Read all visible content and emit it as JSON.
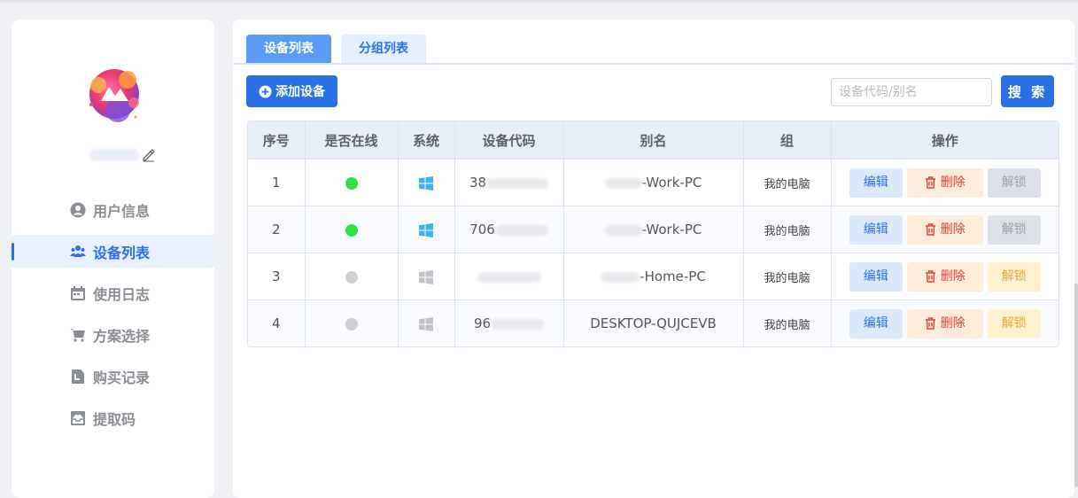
{
  "sidebar": {
    "items": [
      {
        "label": "用户信息",
        "icon": "user-circle-icon",
        "active": false
      },
      {
        "label": "设备列表",
        "icon": "users-group-icon",
        "active": true
      },
      {
        "label": "使用日志",
        "icon": "calendar-icon",
        "active": false
      },
      {
        "label": "方案选择",
        "icon": "cart-icon",
        "active": false
      },
      {
        "label": "购买记录",
        "icon": "document-icon",
        "active": false
      },
      {
        "label": "提取码",
        "icon": "inbox-icon",
        "active": false
      }
    ]
  },
  "tabs": [
    {
      "label": "设备列表",
      "active": true
    },
    {
      "label": "分组列表",
      "active": false
    }
  ],
  "toolbar": {
    "add_label": "添加设备",
    "search_placeholder": "设备代码/别名",
    "search_label": "搜 索"
  },
  "table": {
    "headers": [
      "序号",
      "是否在线",
      "系统",
      "设备代码",
      "别名",
      "组",
      "操作"
    ],
    "rows": [
      {
        "index": "1",
        "online": true,
        "system": "windows-icon",
        "code_visible": "38",
        "alias_visible": "-Work-PC",
        "group": "我的电脑",
        "unlock_enabled": false
      },
      {
        "index": "2",
        "online": true,
        "system": "windows-icon",
        "code_visible": "706",
        "alias_visible": "-Work-PC",
        "group": "我的电脑",
        "unlock_enabled": false
      },
      {
        "index": "3",
        "online": false,
        "system": "windows-icon",
        "code_visible": "",
        "alias_visible": "-Home-PC",
        "group": "我的电脑",
        "unlock_enabled": true
      },
      {
        "index": "4",
        "online": false,
        "system": "windows-icon",
        "code_visible": "96",
        "alias_visible": "DESKTOP-QUJCEVB",
        "group": "我的电脑",
        "unlock_enabled": true
      }
    ],
    "ops": {
      "edit": "编辑",
      "delete": "删除",
      "unlock": "解锁"
    }
  },
  "colors": {
    "accent": "#2a70e5",
    "online": "#2ee043",
    "offline": "#cfcfcf",
    "windows_online": "#3fb2f2",
    "windows_offline": "#bfc3c8",
    "delete": "#e2413a",
    "unlock": "#e8a53b"
  }
}
